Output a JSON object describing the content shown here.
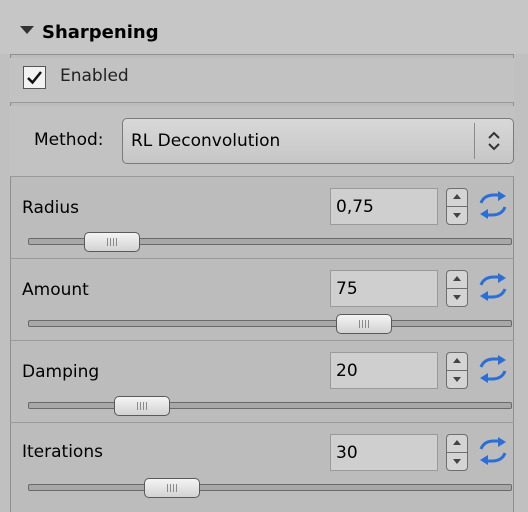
{
  "panel": {
    "title": "Sharpening",
    "enabled": {
      "label": "Enabled",
      "checked": true
    },
    "method": {
      "label": "Method:",
      "value": "RL Deconvolution"
    },
    "params": [
      {
        "label": "Radius",
        "value": "0,75",
        "slider_fraction": 0.13
      },
      {
        "label": "Amount",
        "value": "75",
        "slider_fraction": 0.72
      },
      {
        "label": "Damping",
        "value": "20",
        "slider_fraction": 0.2
      },
      {
        "label": "Iterations",
        "value": "30",
        "slider_fraction": 0.27
      }
    ]
  },
  "icons": {
    "collapse": "triangle-down-icon",
    "checkbox": "checkmark-icon",
    "select": "updown-chevron-icon",
    "spinner": "spinner-arrows-icon",
    "reset": "refresh-icon"
  },
  "colors": {
    "reset_icon": "#2b6fd6",
    "panel_bg": "#c0c0c0"
  }
}
